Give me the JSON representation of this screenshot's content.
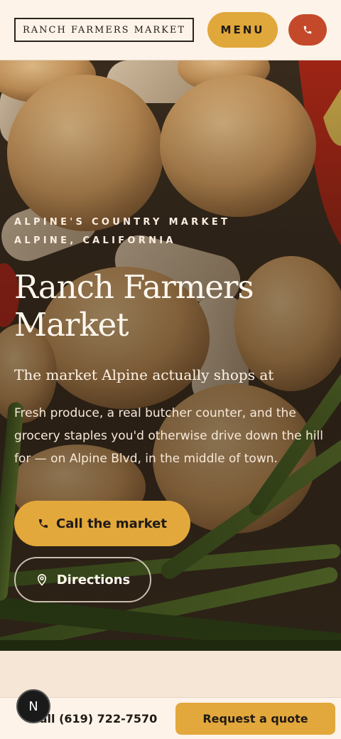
{
  "header": {
    "logo_text": "RANCH FARMERS MARKET",
    "menu_label": "MENU"
  },
  "hero": {
    "eyebrow_line1": "ALPINE'S COUNTRY MARKET",
    "eyebrow_line2": "ALPINE, CALIFORNIA",
    "title": "Ranch Farmers Market",
    "subtitle": "The market Alpine actually shops at",
    "body": "Fresh produce, a real butcher counter, and the grocery staples you'd otherwise drive down the hill for — on Alpine Blvd, in the middle of town.",
    "primary_cta": "Call the market",
    "secondary_cta": "Directions"
  },
  "bottom_bar": {
    "phone_label": "Call (619) 722-7570",
    "quote_label": "Request a quote"
  },
  "badge": {
    "letter": "N"
  },
  "icons": {
    "phone": "phone-icon",
    "location": "location-pin-icon"
  },
  "colors": {
    "accent": "#e0a73a",
    "call_button": "#c4492a",
    "header_bg": "#fdf3e8"
  }
}
